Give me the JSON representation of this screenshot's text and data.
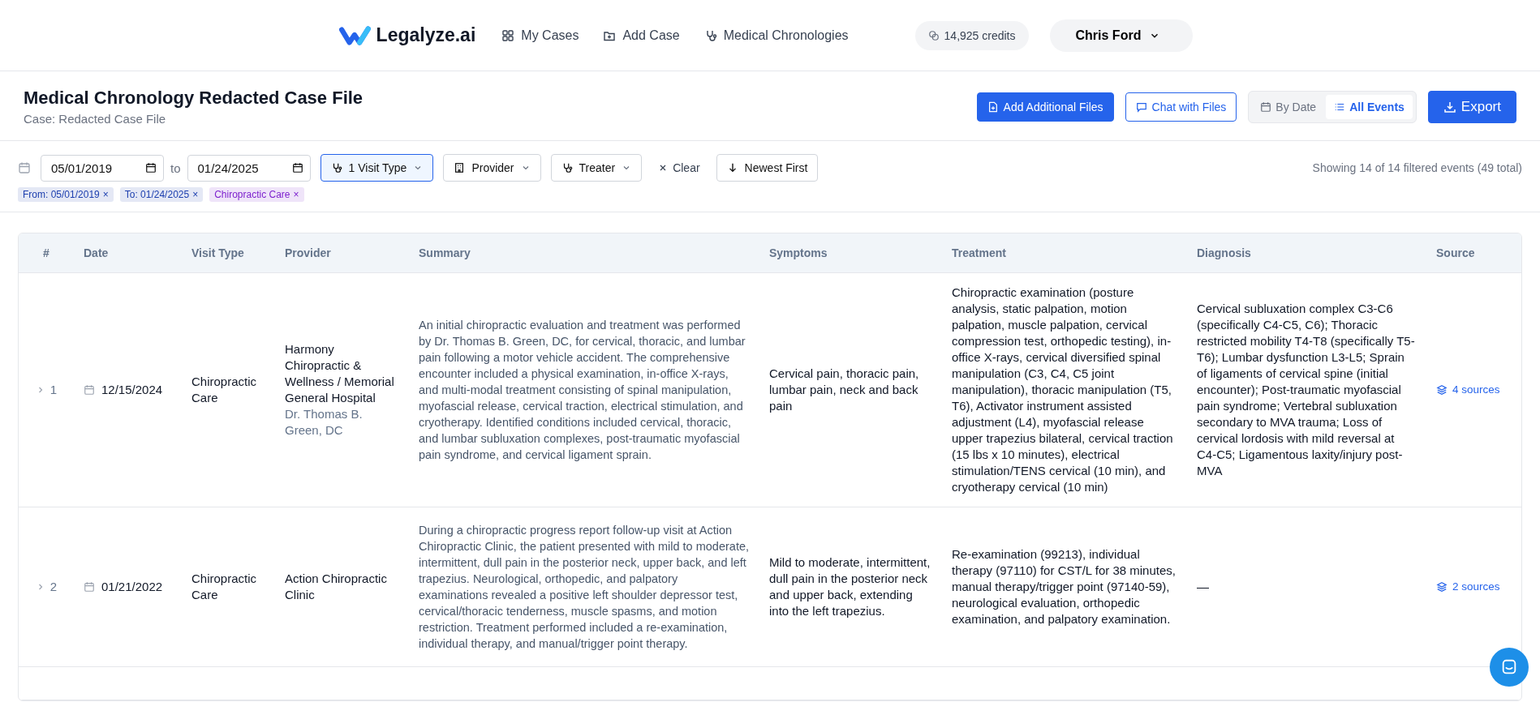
{
  "nav": {
    "logo": "Legalyze.ai",
    "links": [
      {
        "label": "My Cases",
        "kind": "grid"
      },
      {
        "label": "Add Case",
        "kind": "folder"
      },
      {
        "label": "Medical Chronologies",
        "kind": "stethoscope"
      }
    ],
    "credits": "14,925 credits",
    "user": "Chris Ford"
  },
  "page": {
    "title": "Medical Chronology Redacted Case File",
    "subtitle": "Case: Redacted Case File",
    "add_files": "Add Additional Files",
    "chat": "Chat with Files",
    "view_toggle": [
      {
        "label": "By Date",
        "selected": false,
        "kind": "calendar"
      },
      {
        "label": "All Events",
        "selected": true,
        "kind": "list"
      }
    ],
    "export": "Export"
  },
  "filters": {
    "from": "05/01/2019",
    "to_label": "to",
    "to": "01/24/2025",
    "dropdowns": [
      {
        "label": "1 Visit Type",
        "active": true,
        "kind": "stethoscope"
      },
      {
        "label": "Provider",
        "active": false,
        "kind": "building"
      },
      {
        "label": "Treater",
        "active": false,
        "kind": "stethoscope"
      }
    ],
    "clear": "Clear",
    "sort": "Newest First",
    "showing": "Showing 14 of 14 filtered events (49 total)",
    "chips": [
      {
        "label": "From: 05/01/2019",
        "remove": "×",
        "color": "#1e40af"
      },
      {
        "label": "To: 01/24/2025",
        "remove": "×",
        "color": "#1e40af"
      },
      {
        "label": "Chiropractic Care",
        "remove": "×",
        "color": "#7e22ce"
      }
    ]
  },
  "table": {
    "columns": [
      "#",
      "Date",
      "Visit Type",
      "Provider",
      "Summary",
      "Symptoms",
      "Treatment",
      "Diagnosis",
      "Source"
    ],
    "rows": [
      {
        "expanded": false,
        "number": "1",
        "date": "12/15/2024",
        "visit_type": "Chiropractic Care",
        "provider": "Harmony Chiropractic & Wellness / Memorial General Hospital",
        "treater": "Dr. Thomas B. Green, DC",
        "summary": "An initial chiropractic evaluation and treatment was performed by Dr. Thomas B. Green, DC, for cervical, thoracic, and lumbar pain following a motor vehicle accident. The comprehensive encounter included a physical examination, in-office X-rays, and multi-modal treatment consisting of spinal manipulation, myofascial release, cervical traction, electrical stimulation, and cryotherapy. Identified conditions included cervical, thoracic, and lumbar subluxation complexes, post-traumatic myofascial pain syndrome, and cervical ligament sprain.",
        "symptoms": "Cervical pain, thoracic pain, lumbar pain, neck and back pain",
        "treatment": "Chiropractic examination (posture analysis, static palpation, motion palpation, muscle palpation, cervical compression test, orthopedic testing), in-office X-rays, cervical diversified spinal manipulation (C3, C4, C5 joint manipulation), thoracic manipulation (T5, T6), Activator instrument assisted adjustment (L4), myofascial release upper trapezius bilateral, cervical traction (15 lbs x 10 minutes), electrical stimulation/TENS cervical (10 min), and cryotherapy cervical (10 min)",
        "diagnosis": "Cervical subluxation complex C3-C6 (specifically C4-C5, C6); Thoracic restricted mobility T4-T8 (specifically T5-T6); Lumbar dysfunction L3-L5; Sprain of ligaments of cervical spine (initial encounter); Post-traumatic myofascial pain syndrome; Vertebral subluxation secondary to MVA trauma; Loss of cervical lordosis with mild reversal at C4-C5; Ligamentous laxity/injury post-MVA",
        "sources": "4 sources"
      },
      {
        "expanded": false,
        "number": "2",
        "date": "01/21/2022",
        "visit_type": "Chiropractic Care",
        "provider": "Action Chiropractic Clinic",
        "summary": "During a chiropractic progress report follow-up visit at Action Chiropractic Clinic, the patient presented with mild to moderate, intermittent, dull pain in the posterior neck, upper back, and left trapezius. Neurological, orthopedic, and palpatory examinations revealed a positive left shoulder depressor test, cervical/thoracic tenderness, muscle spasms, and motion restriction. Treatment performed included a re-examination, individual therapy, and manual/trigger point therapy.",
        "symptoms": "Mild to moderate, intermittent, dull pain in the posterior neck and upper back, extending into the left trapezius.",
        "treatment": "Re-examination (99213), individual therapy (97110) for CST/L for 38 minutes, manual therapy/trigger point (97140-59), neurological evaluation, orthopedic examination, and palpatory examination.",
        "diagnosis": "—",
        "sources": "2 sources"
      }
    ]
  }
}
